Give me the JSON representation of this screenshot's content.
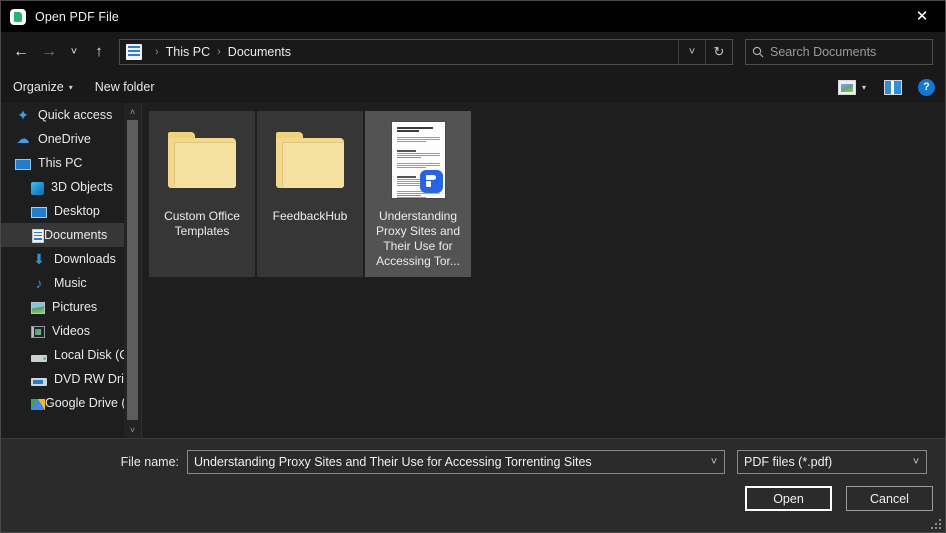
{
  "window": {
    "title": "Open PDF File",
    "title_icon": "pdf-app-icon",
    "close_label": "✕"
  },
  "navigation": {
    "back_icon": "←",
    "forward_icon": "→",
    "recent_icon": "˅",
    "up_icon": "↑",
    "address": {
      "icon": "documents-folder-icon",
      "separator": "›",
      "crumbs": [
        "This PC",
        "Documents"
      ],
      "dropdown_icon": "˅",
      "refresh_icon": "↻"
    },
    "search": {
      "icon": "🔍",
      "placeholder": "Search Documents",
      "value": ""
    }
  },
  "commandbar": {
    "organize_label": "Organize",
    "organize_caret": "▾",
    "new_folder_label": "New folder",
    "view_caret": "▾",
    "help_label": "?"
  },
  "sidebar": {
    "scroll_up_icon": "˄",
    "scroll_down_icon": "˅",
    "items": [
      {
        "label": "Quick access",
        "icon": "star-icon",
        "indent": false,
        "selected": false
      },
      {
        "label": "OneDrive",
        "icon": "cloud-icon",
        "indent": false,
        "selected": false
      },
      {
        "label": "This PC",
        "icon": "monitor-icon",
        "indent": false,
        "selected": false
      },
      {
        "label": "3D Objects",
        "icon": "cube-icon",
        "indent": true,
        "selected": false
      },
      {
        "label": "Desktop",
        "icon": "desktop-icon",
        "indent": true,
        "selected": false
      },
      {
        "label": "Documents",
        "icon": "documents-icon",
        "indent": true,
        "selected": true
      },
      {
        "label": "Downloads",
        "icon": "download-arrow-icon",
        "indent": true,
        "selected": false
      },
      {
        "label": "Music",
        "icon": "music-note-icon",
        "indent": true,
        "selected": false
      },
      {
        "label": "Pictures",
        "icon": "picture-icon",
        "indent": true,
        "selected": false
      },
      {
        "label": "Videos",
        "icon": "video-icon",
        "indent": true,
        "selected": false
      },
      {
        "label": "Local Disk (C:)",
        "icon": "hard-disk-icon",
        "indent": true,
        "selected": false
      },
      {
        "label": "DVD RW Drive (D",
        "icon": "dvd-drive-icon",
        "indent": true,
        "selected": false
      },
      {
        "label": "Google Drive (G:",
        "icon": "google-drive-icon",
        "indent": true,
        "selected": false
      }
    ]
  },
  "files": [
    {
      "name": "Custom Office Templates",
      "type": "folder",
      "selected": false
    },
    {
      "name": "FeedbackHub",
      "type": "folder",
      "selected": false
    },
    {
      "name": "Understanding Proxy Sites and Their Use for Accessing Tor...",
      "type": "document",
      "selected": true
    }
  ],
  "footer": {
    "filename_label": "File name:",
    "filename_value": "Understanding Proxy Sites and Their Use for Accessing Torrenting Sites",
    "filename_placeholder": "File name",
    "filter_value": "PDF files (*.pdf)",
    "combo_caret": "˅",
    "open_label": "Open",
    "cancel_label": "Cancel"
  },
  "colors": {
    "accent_blue": "#1178d4",
    "folder_yellow": "#f2d888",
    "badge_blue": "#2563eb",
    "selection_grey": "#535353"
  }
}
